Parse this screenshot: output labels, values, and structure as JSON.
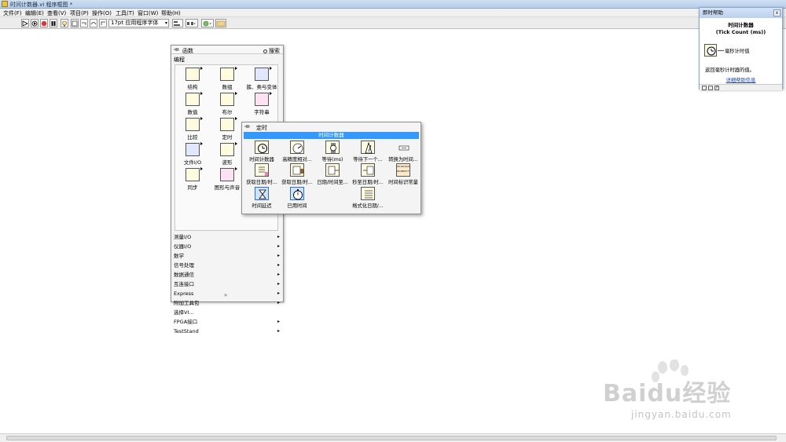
{
  "window": {
    "title": "时间计数器.vi 程序框图 *"
  },
  "menu": [
    "文件(F)",
    "编辑(E)",
    "查看(V)",
    "项目(P)",
    "操作(O)",
    "工具(T)",
    "窗口(W)",
    "帮助(H)"
  ],
  "toolbar": {
    "font": "17pt 应用程序字体"
  },
  "palette": {
    "title": "函数",
    "search": "搜索",
    "category": "编程",
    "items": [
      {
        "label": "结构"
      },
      {
        "label": "数组"
      },
      {
        "label": "簇、类与变体"
      },
      {
        "label": "数值"
      },
      {
        "label": "布尔"
      },
      {
        "label": "字符串"
      },
      {
        "label": "比较"
      },
      {
        "label": "定时"
      },
      {
        "label": ""
      },
      {
        "label": "文件I/O"
      },
      {
        "label": "波形"
      },
      {
        "label": ""
      },
      {
        "label": "同步"
      },
      {
        "label": "图形与声音"
      },
      {
        "label": ""
      }
    ],
    "categories": [
      "测量I/O",
      "仪器I/O",
      "数学",
      "信号处理",
      "数据通信",
      "互连接口",
      "Express",
      "附加工具包",
      "选择VI...",
      "FPGA接口",
      "TestStand"
    ],
    "more": "»"
  },
  "timing": {
    "title": "定时",
    "selected": "时间计数器",
    "items": [
      {
        "label": "时间计数器"
      },
      {
        "label": "高精度相对..."
      },
      {
        "label": "等待(ms)"
      },
      {
        "label": "等待下一个..."
      },
      {
        "label": "转换为时间..."
      },
      {
        "label": "获取日期/时..."
      },
      {
        "label": "获取日期/时..."
      },
      {
        "label": "日期/时间至..."
      },
      {
        "label": "秒至日期/时..."
      },
      {
        "label": "时间标识常量"
      },
      {
        "label": "时间延迟"
      },
      {
        "label": "已用时间"
      },
      {
        "label": ""
      },
      {
        "label": "格式化日期/..."
      },
      {
        "label": ""
      }
    ],
    "const_text": "00:00:00.000 DD/MM/YYYY"
  },
  "context_help": {
    "title": "即时帮助",
    "close": "x",
    "function_name": "时间计数器",
    "function_en": "(Tick Count (ms))",
    "terminal": "毫秒计时值",
    "description": "返回毫秒计时器的值。",
    "link": "详细帮助信息"
  },
  "watermark": {
    "brand": "Baidu经验",
    "url": "jingyan.baidu.com"
  }
}
